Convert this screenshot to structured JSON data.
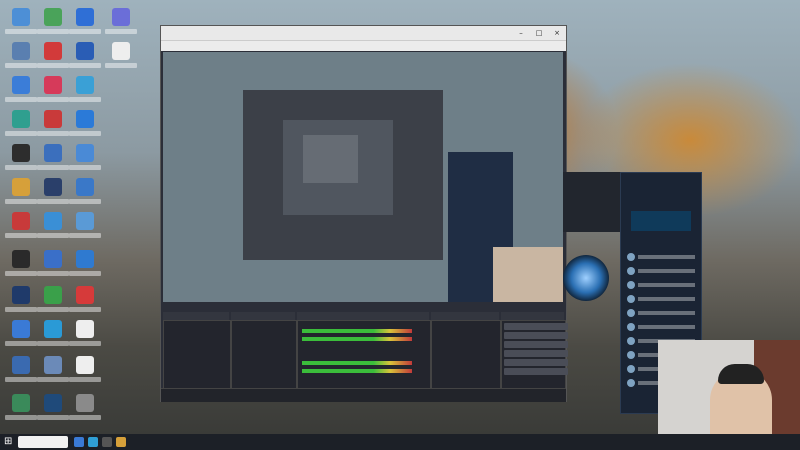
{
  "banner": {
    "line1": "",
    "line2": "",
    "line3": ""
  },
  "obs": {
    "title": "",
    "bottom_docks": [
      "",
      "",
      "",
      "",
      ""
    ],
    "right_panel_timer": ""
  },
  "colors": {
    "banner_yellow": "#fff04a",
    "banner_green": "#6dff6a",
    "obs_bg": "#2b2e38"
  }
}
